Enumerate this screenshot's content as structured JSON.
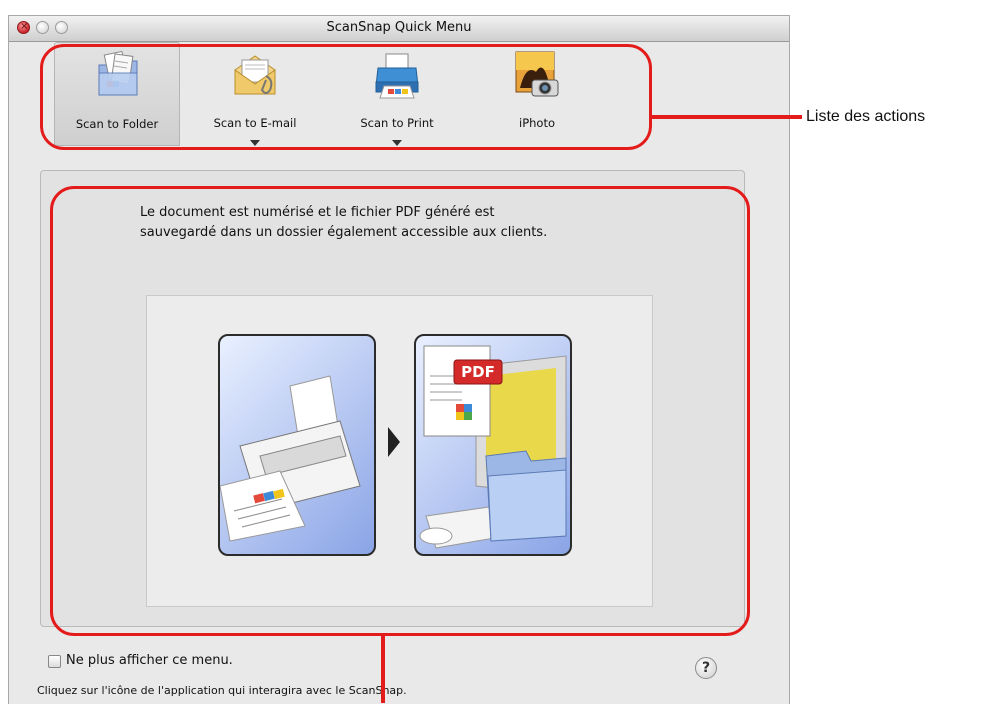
{
  "window": {
    "title": "ScanSnap Quick Menu"
  },
  "actions": [
    {
      "label": "Scan to Folder",
      "icon": "folder-scan-icon",
      "selected": true,
      "has_menu": false
    },
    {
      "label": "Scan to E-mail",
      "icon": "envelope-icon",
      "selected": false,
      "has_menu": true
    },
    {
      "label": "Scan to Print",
      "icon": "printer-icon",
      "selected": false,
      "has_menu": true
    },
    {
      "label": "iPhoto",
      "icon": "iphoto-icon",
      "selected": false,
      "has_menu": false
    }
  ],
  "description": {
    "line1": "Le document est numérisé et le fichier PDF généré est",
    "line2": "sauvegardé dans un dossier également accessible aux clients."
  },
  "illustration": {
    "pdf_badge": "PDF"
  },
  "footer": {
    "checkbox_label": "Ne plus afficher ce menu.",
    "checkbox_checked": false,
    "help_glyph": "?",
    "hint": "Cliquez sur l'icône de l'application qui interagira avec le ScanSnap."
  },
  "annotations": {
    "actions_list_label": "Liste des actions",
    "color": "#e41b1b"
  }
}
